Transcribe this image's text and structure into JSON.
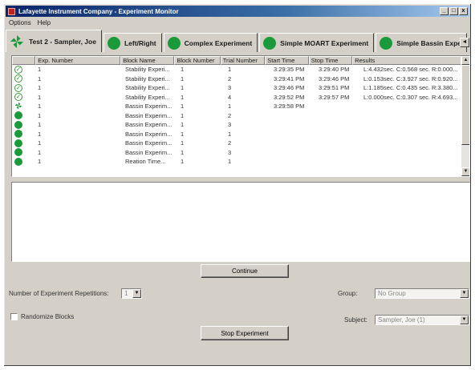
{
  "window": {
    "title": "Lafayette Instrument Company - Experiment Monitor",
    "controls": [
      "_",
      "□",
      "x"
    ]
  },
  "menu": [
    "Options",
    "Help"
  ],
  "tabs": [
    {
      "label": "Test 2 - Sampler, Joe",
      "icon": "pinwheel-icon",
      "active": true
    },
    {
      "label": "Left/Right",
      "icon": "green-circle-icon"
    },
    {
      "label": "Complex Experiment",
      "icon": "green-circle-icon"
    },
    {
      "label": "Simple MOART Experiment",
      "icon": "green-circle-icon"
    },
    {
      "label": "Simple Bassin Expe",
      "icon": "green-circle-icon"
    }
  ],
  "tab_scroll": "◄",
  "table": {
    "columns": [
      "Exp. Number",
      "Block Name",
      "Block Number",
      "Trial Number",
      "Start Time",
      "Stop Time",
      "Results"
    ],
    "rows": [
      {
        "status": "check",
        "exp": "1",
        "block": "Stability Experi...",
        "block_num": "1",
        "trial": "1",
        "start": "3:29:35 PM",
        "stop": "3:29:40 PM",
        "results": "L:4.432sec. C:0.568 sec. R:0.000..."
      },
      {
        "status": "check",
        "exp": "1",
        "block": "Stability Experi...",
        "block_num": "1",
        "trial": "2",
        "start": "3:29:41 PM",
        "stop": "3:29:46 PM",
        "results": "L:0.153sec. C:3.927 sec. R:0.920..."
      },
      {
        "status": "check",
        "exp": "1",
        "block": "Stability Experi...",
        "block_num": "1",
        "trial": "3",
        "start": "3:29:46 PM",
        "stop": "3:29:51 PM",
        "results": "L:1.185sec. C:0.435 sec. R:3.380..."
      },
      {
        "status": "check",
        "exp": "1",
        "block": "Stability Experi...",
        "block_num": "1",
        "trial": "4",
        "start": "3:29:52 PM",
        "stop": "3:29:57 PM",
        "results": "L:0.000sec. C:0.307 sec. R:4.693..."
      },
      {
        "status": "running",
        "exp": "1",
        "block": "Bassin Experim...",
        "block_num": "1",
        "trial": "1",
        "start": "3:29:58 PM",
        "stop": "",
        "results": ""
      },
      {
        "status": "pending",
        "exp": "1",
        "block": "Bassin Experim...",
        "block_num": "1",
        "trial": "2",
        "start": "",
        "stop": "",
        "results": ""
      },
      {
        "status": "pending",
        "exp": "1",
        "block": "Bassin Experim...",
        "block_num": "1",
        "trial": "3",
        "start": "",
        "stop": "",
        "results": ""
      },
      {
        "status": "pending",
        "exp": "1",
        "block": "Bassin Experim...",
        "block_num": "1",
        "trial": "1",
        "start": "",
        "stop": "",
        "results": ""
      },
      {
        "status": "pending",
        "exp": "1",
        "block": "Bassin Experim...",
        "block_num": "1",
        "trial": "2",
        "start": "",
        "stop": "",
        "results": ""
      },
      {
        "status": "pending",
        "exp": "1",
        "block": "Bassin Experim...",
        "block_num": "1",
        "trial": "3",
        "start": "",
        "stop": "",
        "results": ""
      },
      {
        "status": "pending",
        "exp": "1",
        "block": "Reation Time...",
        "block_num": "1",
        "trial": "1",
        "start": "",
        "stop": "",
        "results": ""
      }
    ]
  },
  "continue_button": "Continue",
  "repetitions": {
    "label": "Number of Experiment Repetitions:",
    "value": "1"
  },
  "group": {
    "label": "Group:",
    "value": "No Group"
  },
  "randomize": {
    "label": "Randomize Blocks",
    "checked": false
  },
  "subject": {
    "label": "Subject:",
    "value": "Sampler, Joe (1)"
  },
  "stop_button": "Stop Experiment"
}
